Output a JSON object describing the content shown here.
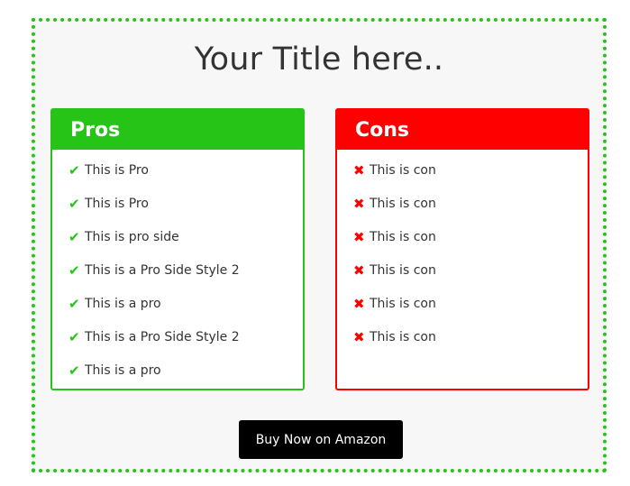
{
  "title": "Your Title here..",
  "pros": {
    "header": "Pros",
    "icon": "check-icon",
    "color": "#25c417",
    "items": [
      "This is Pro",
      "This is Pro",
      "This is pro side",
      "This is a Pro Side Style 2",
      "This is a pro",
      "This is a Pro Side Style 2",
      "This is a pro"
    ]
  },
  "cons": {
    "header": "Cons",
    "icon": "cross-icon",
    "color": "#ff0000",
    "items": [
      "This is con",
      "This is con",
      "This is con",
      "This is con",
      "This is con",
      "This is con"
    ]
  },
  "button": {
    "label": "Buy Now on Amazon"
  }
}
